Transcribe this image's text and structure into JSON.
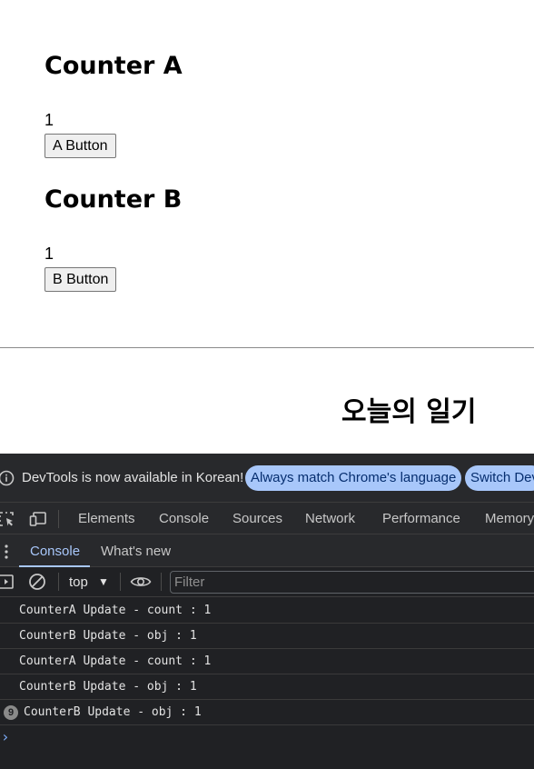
{
  "page": {
    "counter_a": {
      "title": "Counter A",
      "value": "1",
      "button_label": "A Button"
    },
    "counter_b": {
      "title": "Counter B",
      "value": "1",
      "button_label": "B Button"
    },
    "diary_title": "오늘의 일기"
  },
  "devtools": {
    "infobar": {
      "icon": "info-icon",
      "message": "DevTools is now available in Korean!",
      "always_match_label": "Always match Chrome's language",
      "switch_label": "Switch Dev"
    },
    "panel_tabs": [
      "Elements",
      "Console",
      "Sources",
      "Network",
      "Performance",
      "Memory"
    ],
    "drawer": {
      "active_tab": "Console",
      "other_tab": "What's new"
    },
    "filterbar": {
      "context": "top",
      "filter_placeholder": "Filter"
    },
    "console_logs": [
      {
        "text": "CounterA Update - count : 1"
      },
      {
        "text": "CounterB Update - obj : 1"
      },
      {
        "text": "CounterA Update - count : 1"
      },
      {
        "text": "CounterB Update - obj : 1"
      },
      {
        "text": "CounterB Update - obj : 1",
        "repeat": "9"
      }
    ],
    "prompt": "›",
    "colors": {
      "accent": "#a8c7fa",
      "background": "#202124",
      "toolbar": "#28292c"
    }
  }
}
